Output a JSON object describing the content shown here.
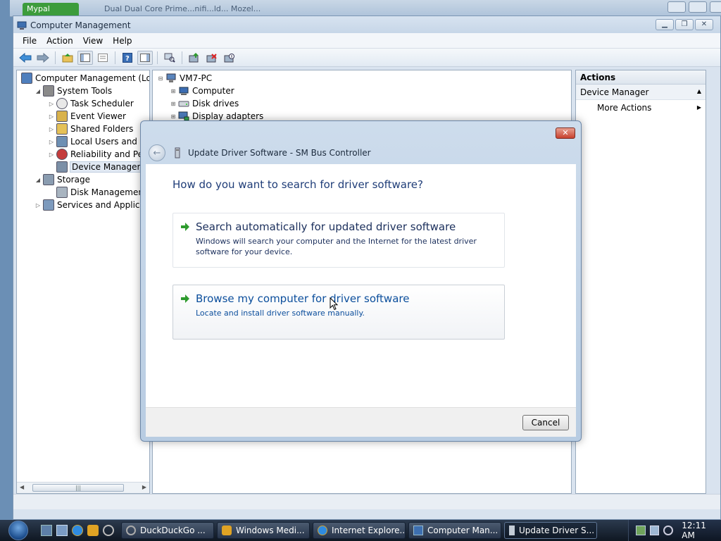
{
  "background_window": {
    "tab_label": "Mypal",
    "title": "Dual Dual Core Prime...nifi...ld... Mozel..."
  },
  "window": {
    "title": "Computer Management",
    "controls": [
      "minimize",
      "restore",
      "close"
    ]
  },
  "menu": [
    "File",
    "Action",
    "View",
    "Help"
  ],
  "toolbar_icons": [
    "back-icon",
    "forward-icon",
    "up-folder-icon",
    "show-hide-console-tree-icon",
    "properties-icon",
    "help-icon",
    "show-hide-action-pane-icon",
    "scan-hardware-icon",
    "update-driver-icon",
    "uninstall-icon",
    "disable-icon"
  ],
  "tree": {
    "items": [
      {
        "label": "Computer Management (Local",
        "level": 0,
        "expander": "",
        "icon": "computer-management-icon"
      },
      {
        "label": "System Tools",
        "level": 1,
        "expander": "expanded",
        "icon": "system-tools-icon"
      },
      {
        "label": "Task Scheduler",
        "level": 2,
        "expander": "collapsed",
        "icon": "clock-icon"
      },
      {
        "label": "Event Viewer",
        "level": 2,
        "expander": "collapsed",
        "icon": "event-viewer-icon"
      },
      {
        "label": "Shared Folders",
        "level": 2,
        "expander": "collapsed",
        "icon": "shared-folders-icon"
      },
      {
        "label": "Local Users and Group",
        "level": 2,
        "expander": "collapsed",
        "icon": "users-icon"
      },
      {
        "label": "Reliability and Perform",
        "level": 2,
        "expander": "collapsed",
        "icon": "reliability-icon"
      },
      {
        "label": "Device Manager",
        "level": 2,
        "expander": "",
        "icon": "device-manager-icon",
        "selected": true
      },
      {
        "label": "Storage",
        "level": 1,
        "expander": "expanded",
        "icon": "storage-icon"
      },
      {
        "label": "Disk Management",
        "level": 2,
        "expander": "",
        "icon": "disk-management-icon"
      },
      {
        "label": "Services and Applications",
        "level": 1,
        "expander": "collapsed",
        "icon": "services-icon"
      }
    ]
  },
  "devices": {
    "root": "VM7-PC",
    "items": [
      "Computer",
      "Disk drives",
      "Display adapters"
    ]
  },
  "actions": {
    "header": "Actions",
    "section": "Device Manager",
    "items": [
      "More Actions"
    ]
  },
  "dialog": {
    "title": "Update Driver Software - SM Bus Controller",
    "question": "How do you want to search for driver software?",
    "options": [
      {
        "title": "Search automatically for updated driver software",
        "desc": "Windows will search your computer and the Internet for the latest driver software for your device."
      },
      {
        "title": "Browse my computer for driver software",
        "desc": "Locate and install driver software manually."
      }
    ],
    "cancel": "Cancel",
    "close_glyph": "✕"
  },
  "taskbar": {
    "quick_launch": [
      "show-desktop-icon",
      "switch-windows-icon",
      "internet-explorer-icon",
      "media-player-icon",
      "sync-icon"
    ],
    "tasks": [
      {
        "label": "DuckDuckGo ...",
        "icon": "duckduckgo-icon"
      },
      {
        "label": "Windows Medi...",
        "icon": "media-player-icon"
      },
      {
        "label": "Internet Explore...",
        "icon": "internet-explorer-icon"
      },
      {
        "label": "Computer Man...",
        "icon": "computer-management-icon"
      },
      {
        "label": "Update Driver S...",
        "icon": "update-driver-icon",
        "active": true
      }
    ],
    "tray_icons": [
      "network-icon",
      "volume-icon",
      "power-icon"
    ],
    "clock": "12:11 AM"
  },
  "colors": {
    "dialog_link_hover": "#0b4e9c",
    "dialog_text": "#1b2f5c",
    "green_arrow": "#2e9b2e"
  }
}
